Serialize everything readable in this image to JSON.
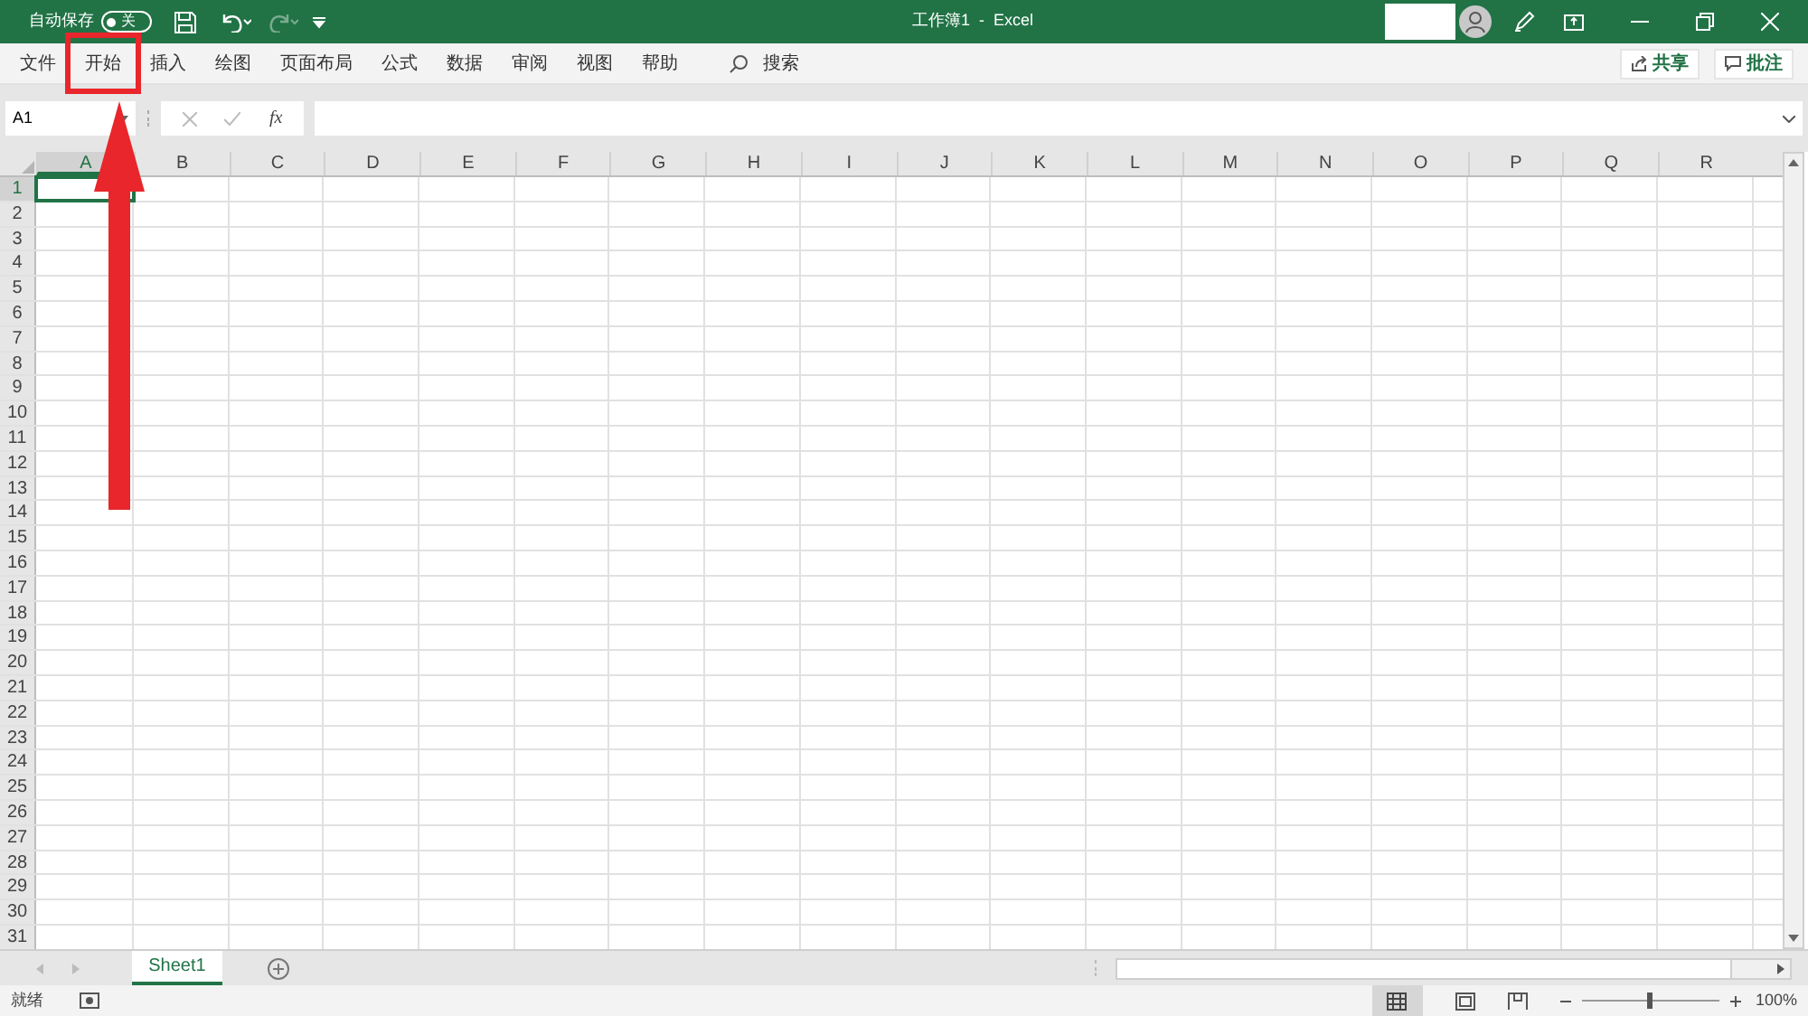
{
  "title_bar": {
    "autosave_label": "自动保存",
    "autosave_toggle": {
      "on": false,
      "label": "关"
    },
    "title": "工作簿1  -  Excel"
  },
  "ribbon_tabs": [
    {
      "label": "文件",
      "annotated": false
    },
    {
      "label": "开始",
      "annotated": true
    },
    {
      "label": "插入",
      "annotated": false
    },
    {
      "label": "绘图",
      "annotated": false
    },
    {
      "label": "页面布局",
      "annotated": false
    },
    {
      "label": "公式",
      "annotated": false
    },
    {
      "label": "数据",
      "annotated": false
    },
    {
      "label": "审阅",
      "annotated": false
    },
    {
      "label": "视图",
      "annotated": false
    },
    {
      "label": "帮助",
      "annotated": false
    }
  ],
  "search_label": "搜索",
  "share_button": "共享",
  "comments_button": "批注",
  "formula_bar": {
    "name_box": "A1",
    "fx": "fx"
  },
  "columns": [
    {
      "label": "A",
      "selected": true
    },
    {
      "label": "B",
      "selected": false
    },
    {
      "label": "C",
      "selected": false
    },
    {
      "label": "D",
      "selected": false
    },
    {
      "label": "E",
      "selected": false
    },
    {
      "label": "F",
      "selected": false
    },
    {
      "label": "G",
      "selected": false
    },
    {
      "label": "H",
      "selected": false
    },
    {
      "label": "I",
      "selected": false
    },
    {
      "label": "J",
      "selected": false
    },
    {
      "label": "K",
      "selected": false
    },
    {
      "label": "L",
      "selected": false
    },
    {
      "label": "M",
      "selected": false
    },
    {
      "label": "N",
      "selected": false
    },
    {
      "label": "O",
      "selected": false
    },
    {
      "label": "P",
      "selected": false
    },
    {
      "label": "Q",
      "selected": false
    },
    {
      "label": "R",
      "selected": false
    }
  ],
  "rows": [
    {
      "label": "1",
      "selected": true
    },
    {
      "label": "2",
      "selected": false
    },
    {
      "label": "3",
      "selected": false
    },
    {
      "label": "4",
      "selected": false
    },
    {
      "label": "5",
      "selected": false
    },
    {
      "label": "6",
      "selected": false
    },
    {
      "label": "7",
      "selected": false
    },
    {
      "label": "8",
      "selected": false
    },
    {
      "label": "9",
      "selected": false
    },
    {
      "label": "10",
      "selected": false
    },
    {
      "label": "11",
      "selected": false
    },
    {
      "label": "12",
      "selected": false
    },
    {
      "label": "13",
      "selected": false
    },
    {
      "label": "14",
      "selected": false
    },
    {
      "label": "15",
      "selected": false
    },
    {
      "label": "16",
      "selected": false
    },
    {
      "label": "17",
      "selected": false
    },
    {
      "label": "18",
      "selected": false
    },
    {
      "label": "19",
      "selected": false
    },
    {
      "label": "20",
      "selected": false
    },
    {
      "label": "21",
      "selected": false
    },
    {
      "label": "22",
      "selected": false
    },
    {
      "label": "23",
      "selected": false
    },
    {
      "label": "24",
      "selected": false
    },
    {
      "label": "25",
      "selected": false
    },
    {
      "label": "26",
      "selected": false
    },
    {
      "label": "27",
      "selected": false
    },
    {
      "label": "28",
      "selected": false
    },
    {
      "label": "29",
      "selected": false
    },
    {
      "label": "30",
      "selected": false
    },
    {
      "label": "31",
      "selected": false
    }
  ],
  "sheet_tabs": [
    {
      "label": "Sheet1",
      "selected": true
    }
  ],
  "status_bar": {
    "status": "就绪",
    "zoom": {
      "level": 0.5,
      "label": "100%"
    }
  }
}
